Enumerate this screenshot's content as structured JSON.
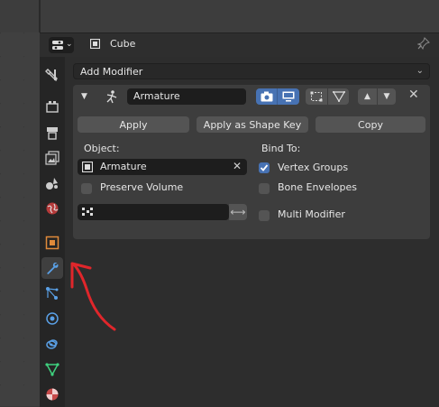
{
  "header": {
    "object_name": "Cube"
  },
  "add_modifier": {
    "label": "Add Modifier"
  },
  "modifier": {
    "name": "Armature",
    "apply_label": "Apply",
    "apply_shape_key_label": "Apply as Shape Key",
    "copy_label": "Copy",
    "object_label": "Object:",
    "object_value": "Armature",
    "bind_to_label": "Bind To:",
    "preserve_volume": {
      "label": "Preserve Volume",
      "checked": false
    },
    "vertex_groups": {
      "label": "Vertex Groups",
      "checked": true
    },
    "bone_envelopes": {
      "label": "Bone Envelopes",
      "checked": false
    },
    "multi_modifier": {
      "label": "Multi Modifier",
      "checked": false
    },
    "vertex_group_value": ""
  },
  "colors": {
    "accent": "#4772b3",
    "annotation": "#e0262b",
    "wrench_active": "#5aa0e6"
  }
}
